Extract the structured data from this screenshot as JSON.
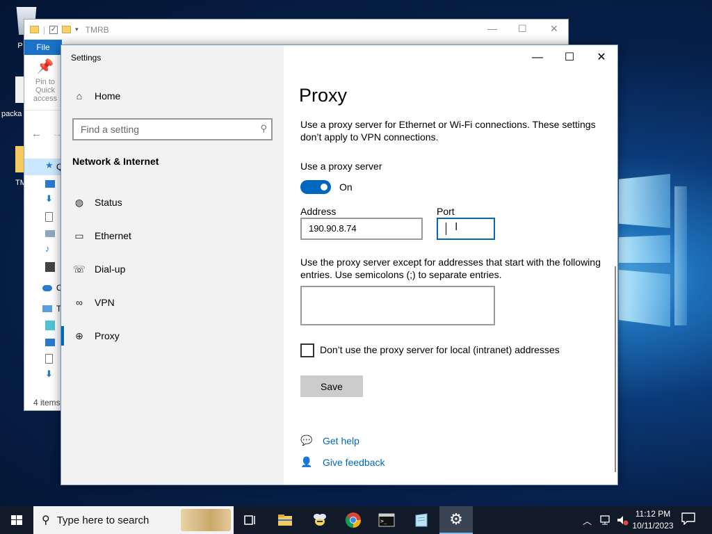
{
  "desktop": {
    "icons": [
      {
        "label": "P"
      },
      {
        "label": "packa"
      },
      {
        "label": "TM"
      }
    ]
  },
  "explorer": {
    "title": "TMRB",
    "file_tab": "File",
    "pin_label": "Pin to Quick access",
    "tree_items": [
      {
        "label": "Q",
        "icon": "star-icon"
      },
      {
        "label": "",
        "icon": "desktop-icon"
      },
      {
        "label": "",
        "icon": "download-icon"
      },
      {
        "label": "",
        "icon": "document-icon"
      },
      {
        "label": "",
        "icon": "picture-icon"
      },
      {
        "label": "",
        "icon": "music-icon"
      },
      {
        "label": "",
        "icon": "video-icon"
      },
      {
        "label": "O",
        "icon": "cloud-icon"
      },
      {
        "label": "T",
        "icon": "pc-icon"
      },
      {
        "label": "",
        "icon": "3d-objects-icon"
      },
      {
        "label": "",
        "icon": "desktop-icon"
      },
      {
        "label": "",
        "icon": "document-icon"
      },
      {
        "label": "",
        "icon": "download-icon"
      }
    ],
    "status": "4 items"
  },
  "settings": {
    "window_title": "Settings",
    "home_label": "Home",
    "search_placeholder": "Find a setting",
    "section_header": "Network & Internet",
    "nav_items": [
      {
        "label": "Status",
        "icon": "globe-status-icon"
      },
      {
        "label": "Ethernet",
        "icon": "ethernet-icon"
      },
      {
        "label": "Dial-up",
        "icon": "dialup-icon"
      },
      {
        "label": "VPN",
        "icon": "vpn-icon"
      },
      {
        "label": "Proxy",
        "icon": "globe-icon"
      }
    ],
    "page_title": "Proxy",
    "intro": "Use a proxy server for Ethernet or Wi-Fi connections. These settings don’t apply to VPN connections.",
    "use_proxy_label": "Use a proxy server",
    "toggle_state": "On",
    "address_label": "Address",
    "address_value": "190.90.8.74",
    "port_label": "Port",
    "port_value": "",
    "exceptions_text": "Use the proxy server except for addresses that start with the following entries. Use semicolons (;) to separate entries.",
    "exceptions_value": "",
    "local_checkbox_label": "Don’t use the proxy server for local (intranet) addresses",
    "local_checked": false,
    "save_label": "Save",
    "get_help": "Get help",
    "give_feedback": "Give feedback"
  },
  "taskbar": {
    "search_placeholder": "Type here to search",
    "apps": [
      "task-view-icon",
      "file-explorer-icon",
      "bee-app-icon",
      "chrome-icon",
      "terminal-icon",
      "notepad-icon",
      "settings-gear-icon"
    ],
    "time": "11:12 PM",
    "date": "10/11/2023"
  },
  "colors": {
    "accent": "#0067c0",
    "settings_left_bg": "#f2f2f2",
    "taskbar_bg": "#101a28"
  }
}
